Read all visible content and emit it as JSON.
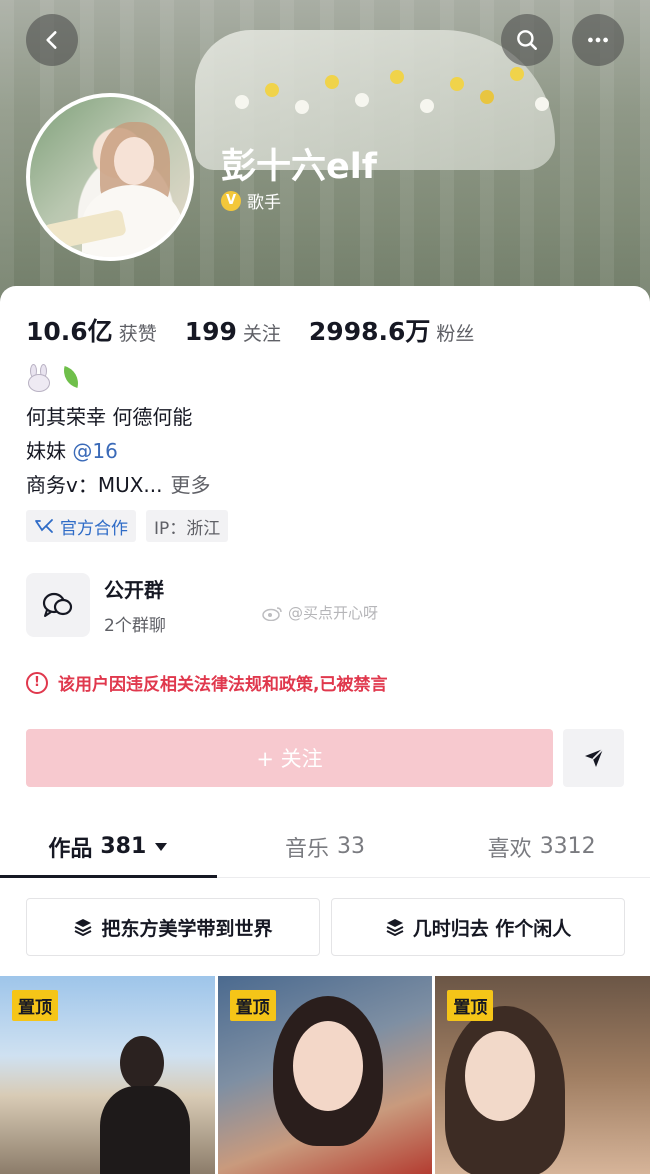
{
  "profile": {
    "name": "彭十六elf",
    "verify_icon": "V",
    "verify_title": "歌手"
  },
  "stats": [
    {
      "value": "10.6亿",
      "label": "获赞"
    },
    {
      "value": "199",
      "label": "关注"
    },
    {
      "value": "2998.6万",
      "label": "粉丝"
    }
  ],
  "bio": {
    "emojis": [
      "rabbit-emoji",
      "leaf-emoji"
    ],
    "line1": "何其荣幸 何德何能",
    "line2_prefix": "妹妹 ",
    "line2_mention": "@16",
    "line3": "商务v：MUX...",
    "more": "更多"
  },
  "tags": {
    "official": "官方合作",
    "ip": "IP：浙江"
  },
  "group": {
    "title": "公开群",
    "subtitle": "2个群聊"
  },
  "watermark": "@买点开心呀",
  "warning": "该用户因违反相关法律法规和政策,已被禁言",
  "actions": {
    "follow": "+ 关注"
  },
  "tabs": [
    {
      "label": "作品",
      "count": "381"
    },
    {
      "label": "音乐",
      "count": "33"
    },
    {
      "label": "喜欢",
      "count": "3312"
    }
  ],
  "collections": [
    "把东方美学带到世界",
    "几时归去 作个闲人"
  ],
  "videos": [
    {
      "badge": "置顶"
    },
    {
      "badge": "置顶"
    },
    {
      "badge": "置顶"
    }
  ],
  "colors": {
    "follow_disabled": "#f7c9cf",
    "warning": "#e0384d",
    "mention": "#3a6ab8",
    "pin_badge": "#f5c518"
  }
}
